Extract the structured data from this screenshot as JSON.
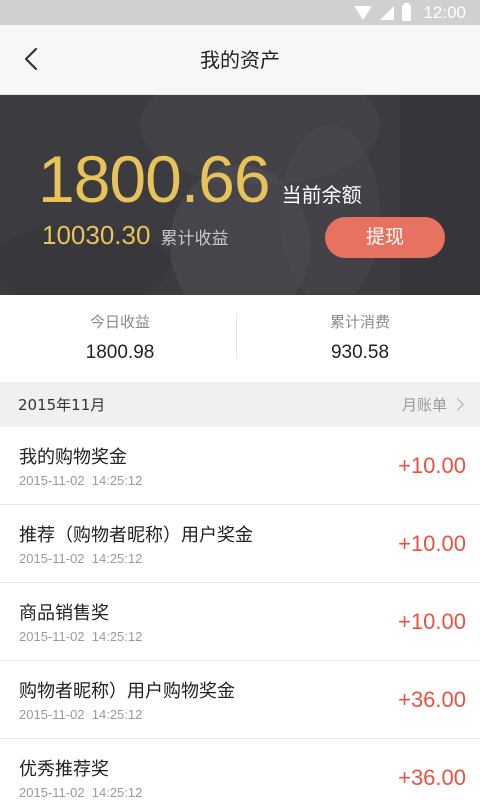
{
  "status_bar": {
    "time": "12:00"
  },
  "header": {
    "title": "我的资产",
    "back_icon": "chevron-left-icon"
  },
  "balance": {
    "amount": "1800.66",
    "label": "当前余额",
    "cumulative_income": "10030.30",
    "cumulative_income_label": "累计收益",
    "withdraw_label": "提现"
  },
  "stats": {
    "today_income_label": "今日收益",
    "today_income_value": "1800.98",
    "total_spend_label": "累计消费",
    "total_spend_value": "930.58"
  },
  "month": {
    "label": "2015年11月",
    "bill_link": "月账单"
  },
  "transactions": [
    {
      "title": "我的购物奖金",
      "time": "2015-11-02  14:25:12",
      "amount": "+10.00"
    },
    {
      "title": "推荐（购物者昵称）用户奖金",
      "time": "2015-11-02  14:25:12",
      "amount": "+10.00"
    },
    {
      "title": "商品销售奖",
      "time": "2015-11-02  14:25:12",
      "amount": "+10.00"
    },
    {
      "title": "购物者昵称）用户购物奖金",
      "time": "2015-11-02  14:25:12",
      "amount": "+36.00"
    },
    {
      "title": "优秀推荐奖",
      "time": "2015-11-02  14:25:12",
      "amount": "+36.00"
    }
  ],
  "colors": {
    "accent_gold": "#e8c35a",
    "button_red": "#e87262",
    "amount_red": "#e8523f"
  }
}
